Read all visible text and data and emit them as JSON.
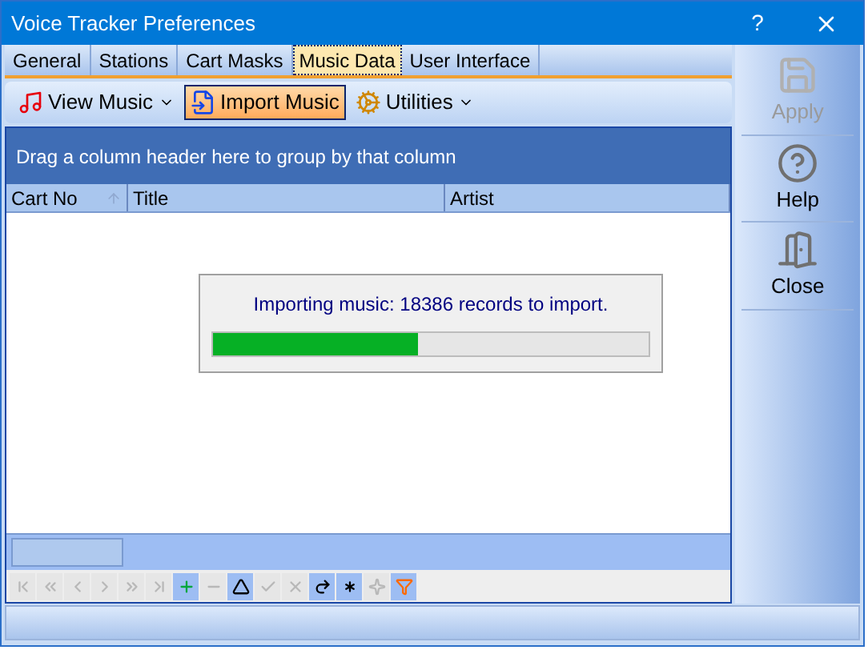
{
  "window": {
    "title": "Voice Tracker Preferences",
    "help_glyph": "?"
  },
  "tabs": [
    {
      "label": "General",
      "selected": false
    },
    {
      "label": "Stations",
      "selected": false
    },
    {
      "label": "Cart Masks",
      "selected": false
    },
    {
      "label": "Music Data",
      "selected": true
    },
    {
      "label": "User Interface",
      "selected": false
    }
  ],
  "toolbar": [
    {
      "kind": "view",
      "label": "View Music",
      "dropdown": true,
      "selected": false
    },
    {
      "kind": "import",
      "label": "Import Music",
      "dropdown": false,
      "selected": true
    },
    {
      "kind": "utilities",
      "label": "Utilities",
      "dropdown": true,
      "selected": false
    }
  ],
  "group_panel": {
    "text": "Drag a column header here to group by that column"
  },
  "table": {
    "columns": [
      {
        "label": "Cart No",
        "sorted": true
      },
      {
        "label": "Title",
        "sorted": false
      },
      {
        "label": "Artist",
        "sorted": false
      }
    ]
  },
  "progress": {
    "message": "Importing music: 18386 records to import.",
    "level": 0.47
  },
  "navigator": [
    {
      "kind": "first",
      "disabled": true
    },
    {
      "kind": "prev_page",
      "disabled": true
    },
    {
      "kind": "prev",
      "disabled": true
    },
    {
      "kind": "next",
      "disabled": true
    },
    {
      "kind": "next_page",
      "disabled": true
    },
    {
      "kind": "last",
      "disabled": true
    },
    {
      "kind": "insert",
      "disabled": false
    },
    {
      "kind": "delete",
      "disabled": true
    },
    {
      "kind": "edit",
      "disabled": false
    },
    {
      "kind": "post",
      "disabled": true
    },
    {
      "kind": "cancel",
      "disabled": true
    },
    {
      "kind": "refresh",
      "disabled": false
    },
    {
      "kind": "bookmark",
      "disabled": false
    },
    {
      "kind": "goto_bookmark",
      "disabled": true
    },
    {
      "kind": "filter",
      "disabled": false
    }
  ],
  "side_buttons": [
    {
      "kind": "apply",
      "label": "Apply",
      "disabled": true
    },
    {
      "kind": "help",
      "label": "Help",
      "disabled": false
    },
    {
      "kind": "close",
      "label": "Close",
      "disabled": false
    }
  ]
}
